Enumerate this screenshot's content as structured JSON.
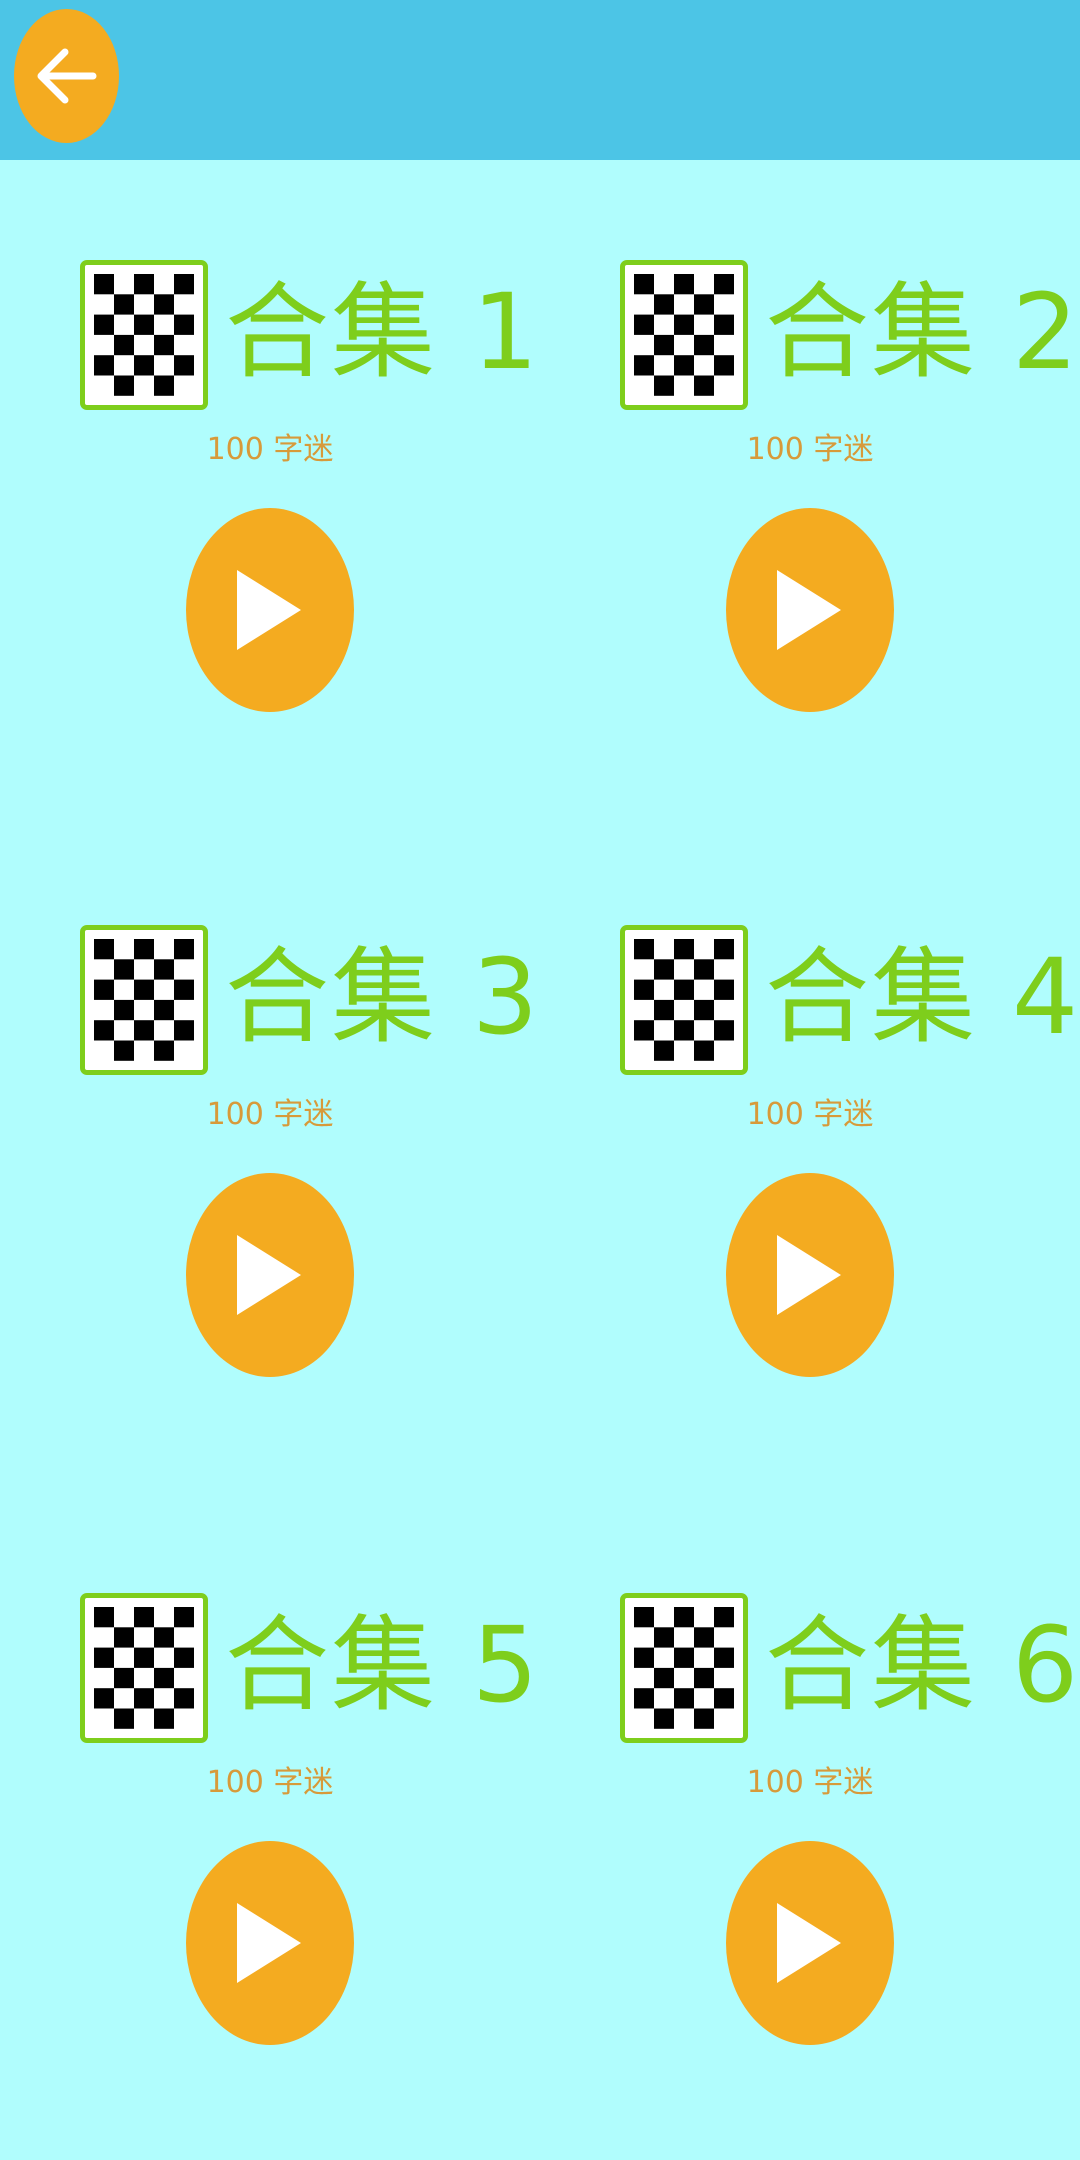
{
  "header": {
    "back_icon": "arrow-left-icon",
    "background_color": "#4cc5e6",
    "button_color": "#f4ab20"
  },
  "collections": [
    {
      "title": "合集 1",
      "subtitle": "100 字迷"
    },
    {
      "title": "合集 2",
      "subtitle": "100 字迷"
    },
    {
      "title": "合集 3",
      "subtitle": "100 字迷"
    },
    {
      "title": "合集 4",
      "subtitle": "100 字迷"
    },
    {
      "title": "合集 5",
      "subtitle": "100 字迷"
    },
    {
      "title": "合集 6",
      "subtitle": "100 字迷"
    }
  ],
  "colors": {
    "page_background": "#b0fdfd",
    "title": "#7ece1c",
    "subtitle": "#d79a3a",
    "play_button": "#f4ab20"
  },
  "icons": {
    "card_icon": "checkerboard-icon",
    "play_icon": "play-icon"
  }
}
